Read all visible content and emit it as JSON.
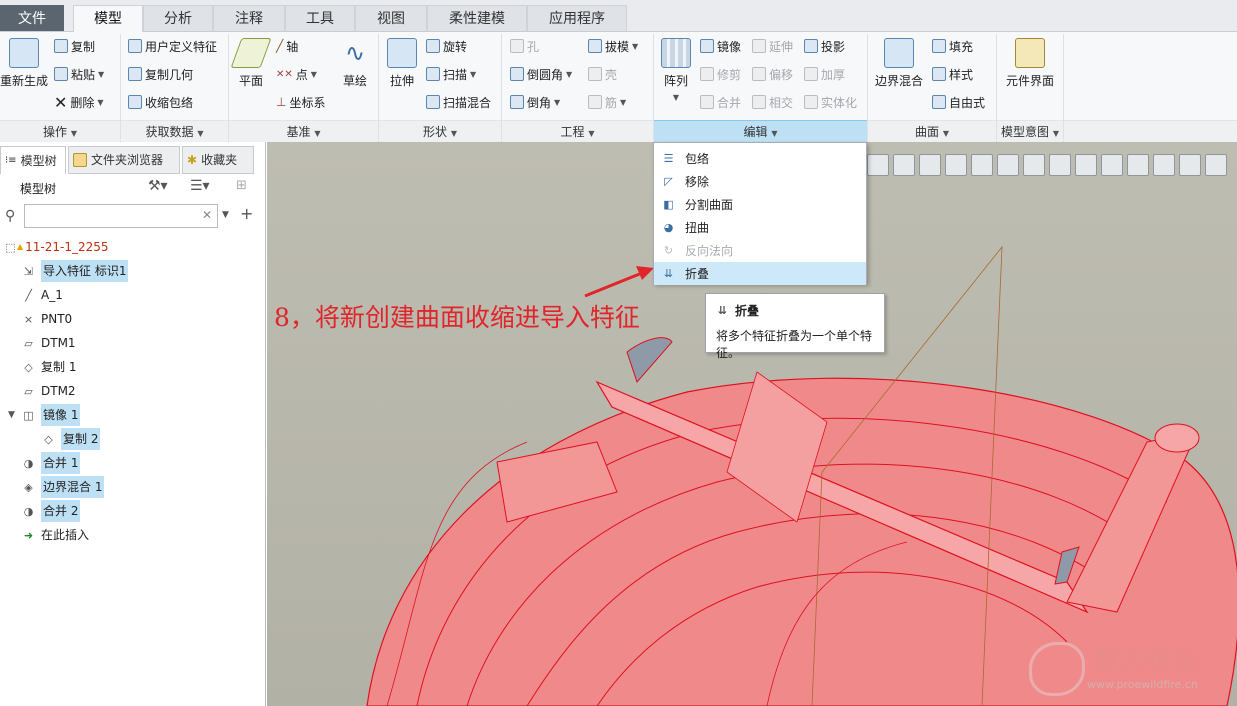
{
  "tabs": [
    "文件",
    "模型",
    "分析",
    "注释",
    "工具",
    "视图",
    "柔性建模",
    "应用程序"
  ],
  "active_tab": "模型",
  "ribbon": {
    "operations": {
      "label": "操作",
      "regen": "重新生成",
      "copy": "复制",
      "paste": "粘贴",
      "delete": "删除"
    },
    "get_data": {
      "label": "获取数据",
      "udf": "用户定义特征",
      "copy_geom": "复制几何",
      "shrinkwrap": "收缩包络"
    },
    "datum": {
      "label": "基准",
      "plane": "平面",
      "axis": "轴",
      "point": "点",
      "csys": "坐标系",
      "sketch": "草绘"
    },
    "shapes": {
      "label": "形状",
      "extrude": "拉伸",
      "revolve": "旋转",
      "sweep": "扫描",
      "swept_blend": "扫描混合"
    },
    "engineering": {
      "label": "工程",
      "hole": "孔",
      "round": "倒圆角",
      "chamfer": "倒角",
      "draft": "拔模",
      "shell": "壳",
      "rib": "筋"
    },
    "editing": {
      "label": "编辑",
      "pattern": "阵列",
      "mirror": "镜像",
      "extend": "延伸",
      "project": "投影",
      "trim": "修剪",
      "offset": "偏移",
      "thicken": "加厚",
      "merge": "合并",
      "intersect": "相交",
      "solidify": "实体化"
    },
    "surfaces": {
      "label": "曲面",
      "boundary_blend": "边界混合",
      "fill": "填充",
      "style": "样式",
      "freestyle": "自由式"
    },
    "model_intent": {
      "label": "模型意图",
      "component_interface": "元件界面"
    }
  },
  "left_panel": {
    "tabs": [
      "模型树",
      "文件夹浏览器",
      "收藏夹"
    ],
    "title": "模型树",
    "filter_placeholder": "",
    "tree": [
      {
        "label": "11-21-1_2255",
        "level": 0,
        "icon": "part-icon",
        "selected": false,
        "root": true
      },
      {
        "label": "导入特征 标识1",
        "level": 1,
        "icon": "import-feature-icon",
        "selected": true
      },
      {
        "label": "A_1",
        "level": 1,
        "icon": "axis-icon",
        "selected": false
      },
      {
        "label": "PNT0",
        "level": 1,
        "icon": "point-icon",
        "selected": false
      },
      {
        "label": "DTM1",
        "level": 1,
        "icon": "datum-plane-icon",
        "selected": false
      },
      {
        "label": "复制 1",
        "level": 1,
        "icon": "copy-surface-icon",
        "selected": false
      },
      {
        "label": "DTM2",
        "level": 1,
        "icon": "datum-plane-icon",
        "selected": false
      },
      {
        "label": "镜像 1",
        "level": 1,
        "icon": "mirror-icon",
        "selected": true,
        "expanded": true
      },
      {
        "label": "复制 2",
        "level": 2,
        "icon": "copy-surface-icon",
        "selected": true
      },
      {
        "label": "合并 1",
        "level": 1,
        "icon": "merge-icon",
        "selected": true
      },
      {
        "label": "边界混合 1",
        "level": 1,
        "icon": "boundary-blend-icon",
        "selected": true
      },
      {
        "label": "合并 2",
        "level": 1,
        "icon": "merge-icon",
        "selected": true
      },
      {
        "label": "在此插入",
        "level": 1,
        "icon": "insert-here-icon",
        "selected": false
      }
    ]
  },
  "dropdown": {
    "items": [
      {
        "label": "包络",
        "icon": "wrap-icon",
        "disabled": false,
        "highlight": false
      },
      {
        "label": "移除",
        "icon": "remove-icon",
        "disabled": false,
        "highlight": false
      },
      {
        "label": "分割曲面",
        "icon": "split-surface-icon",
        "disabled": false,
        "highlight": false
      },
      {
        "label": "扭曲",
        "icon": "warp-icon",
        "disabled": false,
        "highlight": false
      },
      {
        "label": "反向法向",
        "icon": "flip-normal-icon",
        "disabled": true,
        "highlight": false
      },
      {
        "label": "折叠",
        "icon": "collapse-icon",
        "disabled": false,
        "highlight": true
      }
    ]
  },
  "tooltip": {
    "title": "折叠",
    "desc": "将多个特征折叠为一个单个特征。"
  },
  "annotation": "8，将新创建曲面收缩进导入特征",
  "watermark": {
    "cn": "野火论坛",
    "url": "www.proewildfire.cn"
  },
  "colors": {
    "accent": "#bde0f4",
    "annotation": "#e0252b",
    "model_fill": "#f08a8a",
    "model_edge": "#e01020",
    "viewport_bg": "#bebdb1"
  }
}
